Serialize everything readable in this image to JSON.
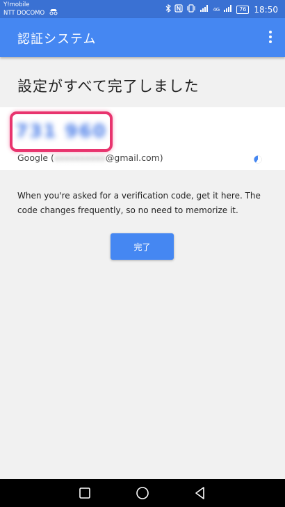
{
  "status_bar": {
    "carrier_line1": "Y!mobile",
    "carrier_line2": "NTT DOCOMO",
    "network_label": "4G",
    "battery_level": "76",
    "time": "18:50",
    "icons": [
      "incognito-icon",
      "bluetooth-icon",
      "nfc-icon",
      "vibrate-icon",
      "signal-icon",
      "battery-icon"
    ]
  },
  "app_bar": {
    "title": "認証システム",
    "menu_icon": "more-vert-icon"
  },
  "page": {
    "headline": "設定がすべて完了しました"
  },
  "account": {
    "code": "731 960",
    "account_prefix": "Google (",
    "email_hidden": "xxxxxxxxxx",
    "account_suffix": "@gmail.com)",
    "timer_icon": "countdown-timer-icon",
    "accent_color": "#4587f2"
  },
  "description": "When you're asked for a verification code, get it here. The code changes frequently, so no need to memorize it.",
  "done_button": {
    "label": "完了"
  },
  "nav_bar": {
    "buttons": [
      "recents-icon",
      "home-icon",
      "back-icon"
    ]
  },
  "colors": {
    "status_bar": "#3a71d3",
    "app_bar": "#4587f2",
    "highlight": "#e8346e",
    "background": "#f1f1f1"
  }
}
